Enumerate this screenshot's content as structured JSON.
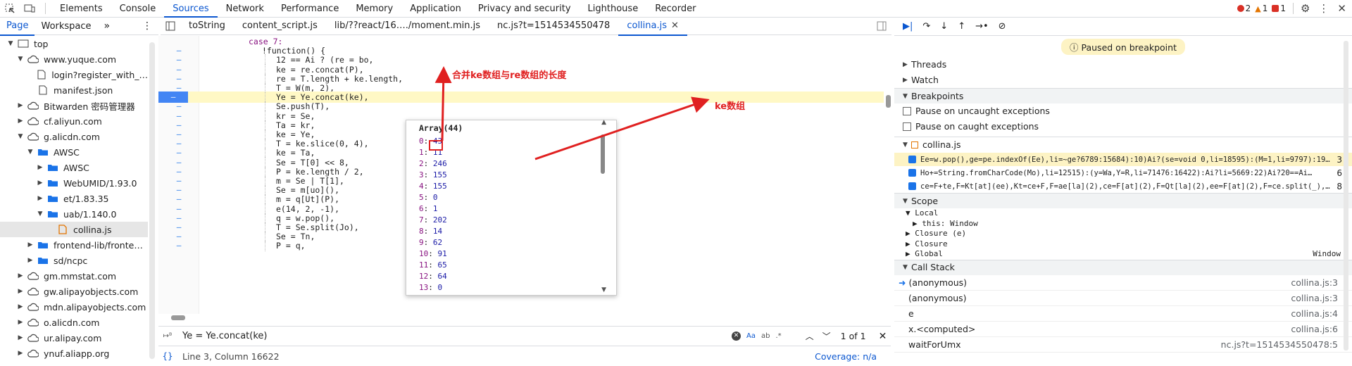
{
  "toolbar": {
    "tabs": [
      "Elements",
      "Console",
      "Sources",
      "Network",
      "Performance",
      "Memory",
      "Application",
      "Privacy and security",
      "Lighthouse",
      "Recorder"
    ],
    "active": "Sources",
    "errors": "2",
    "warnings": "1",
    "issues": "1"
  },
  "navigator": {
    "tabs": [
      "Page",
      "Workspace"
    ],
    "more": "»"
  },
  "tree": [
    {
      "label": "top",
      "depth": 0,
      "arrow": "▼",
      "icon": "frame"
    },
    {
      "label": "www.yuque.com",
      "depth": 1,
      "arrow": "▼",
      "icon": "cloud"
    },
    {
      "label": "login?register_with_…",
      "depth": 2,
      "arrow": "",
      "icon": "file"
    },
    {
      "label": "manifest.json",
      "depth": 2,
      "arrow": "",
      "icon": "file"
    },
    {
      "label": "Bitwarden 密码管理器",
      "depth": 1,
      "arrow": "▶",
      "icon": "cloud"
    },
    {
      "label": "cf.aliyun.com",
      "depth": 1,
      "arrow": "▶",
      "icon": "cloud"
    },
    {
      "label": "g.alicdn.com",
      "depth": 1,
      "arrow": "▼",
      "icon": "cloud"
    },
    {
      "label": "AWSC",
      "depth": 2,
      "arrow": "▼",
      "icon": "folder"
    },
    {
      "label": "AWSC",
      "depth": 3,
      "arrow": "▶",
      "icon": "folder"
    },
    {
      "label": "WebUMID/1.93.0",
      "depth": 3,
      "arrow": "▶",
      "icon": "folder"
    },
    {
      "label": "et/1.83.35",
      "depth": 3,
      "arrow": "▶",
      "icon": "folder"
    },
    {
      "label": "uab/1.140.0",
      "depth": 3,
      "arrow": "▼",
      "icon": "folder"
    },
    {
      "label": "collina.js",
      "depth": 4,
      "arrow": "",
      "icon": "jsfile",
      "selected": true
    },
    {
      "label": "frontend-lib/fronte…",
      "depth": 2,
      "arrow": "▶",
      "icon": "folder"
    },
    {
      "label": "sd/ncpc",
      "depth": 2,
      "arrow": "▶",
      "icon": "folder"
    },
    {
      "label": "gm.mmstat.com",
      "depth": 1,
      "arrow": "▶",
      "icon": "cloud"
    },
    {
      "label": "gw.alipayobjects.com",
      "depth": 1,
      "arrow": "▶",
      "icon": "cloud"
    },
    {
      "label": "mdn.alipayobjects.com",
      "depth": 1,
      "arrow": "▶",
      "icon": "cloud"
    },
    {
      "label": "o.alicdn.com",
      "depth": 1,
      "arrow": "▶",
      "icon": "cloud"
    },
    {
      "label": "ur.alipay.com",
      "depth": 1,
      "arrow": "▶",
      "icon": "cloud"
    },
    {
      "label": "ynuf.aliapp.org",
      "depth": 1,
      "arrow": "▶",
      "icon": "cloud"
    }
  ],
  "editor_tabs": [
    "toString",
    "content_script.js",
    "lib/??react/16…./moment.min.js",
    "nc.js?t=1514534550478",
    "collina.js"
  ],
  "active_editor_tab": "collina.js",
  "code_lines": [
    {
      "indent": 0,
      "text": "case 7:",
      "gutter": ""
    },
    {
      "indent": 1,
      "text": "!function() {",
      "gutter": "–"
    },
    {
      "indent": 2,
      "text": "12 == Ai ? (re = bo,",
      "gutter": "–"
    },
    {
      "indent": 2,
      "text": "ke = re.concat(P),",
      "gutter": "–"
    },
    {
      "indent": 2,
      "text": "re = T.length + ke.length,",
      "gutter": "–"
    },
    {
      "indent": 2,
      "text": "T = W(m, 2),",
      "gutter": "–"
    },
    {
      "indent": 2,
      "text": "Ye = Ye.concat(ke),",
      "gutter": "–",
      "current": true
    },
    {
      "indent": 2,
      "text": "Se.push(T),",
      "gutter": "–"
    },
    {
      "indent": 2,
      "text": "kr = Se,",
      "gutter": "–"
    },
    {
      "indent": 2,
      "text": "Ta = kr,",
      "gutter": "–"
    },
    {
      "indent": 2,
      "text": "ke = Ye,",
      "gutter": "–"
    },
    {
      "indent": 2,
      "text": "T = ke.slice(0, 4),",
      "gutter": "–"
    },
    {
      "indent": 2,
      "text": "ke = Ta,",
      "gutter": "–"
    },
    {
      "indent": 2,
      "text": "Se = T[0] << 8,",
      "gutter": "–"
    },
    {
      "indent": 2,
      "text": "P = ke.length / 2,",
      "gutter": "–"
    },
    {
      "indent": 2,
      "text": "m = Se | T[1],",
      "gutter": "–"
    },
    {
      "indent": 2,
      "text": "Se = m[uo](),",
      "gutter": "–"
    },
    {
      "indent": 2,
      "text": "m = q[Ut](P),",
      "gutter": "–"
    },
    {
      "indent": 2,
      "text": "e(14, 2, -1),",
      "gutter": "–"
    },
    {
      "indent": 2,
      "text": "q = w.pop(),",
      "gutter": "–"
    },
    {
      "indent": 2,
      "text": "T = Se.split(Jo),",
      "gutter": "–"
    },
    {
      "indent": 2,
      "text": "Se = Tn,",
      "gutter": "–"
    },
    {
      "indent": 2,
      "text": "P = q,",
      "gutter": "–"
    }
  ],
  "popup": {
    "title": "Array(44)",
    "items": [
      [
        "0",
        "43"
      ],
      [
        "1",
        "11"
      ],
      [
        "2",
        "246"
      ],
      [
        "3",
        "155"
      ],
      [
        "4",
        "155"
      ],
      [
        "5",
        "0"
      ],
      [
        "6",
        "1"
      ],
      [
        "7",
        "202"
      ],
      [
        "8",
        "14"
      ],
      [
        "9",
        "62"
      ],
      [
        "10",
        "91"
      ],
      [
        "11",
        "65"
      ],
      [
        "12",
        "64"
      ],
      [
        "13",
        "0"
      ]
    ]
  },
  "annotations": {
    "a1": "合并ke数组与re数组的长度",
    "a2": "ke数组"
  },
  "search": {
    "query": "Ye = Ye.concat(ke)",
    "aa": "Aa",
    "regex": ".*",
    "count": "1 of 1"
  },
  "status": {
    "position": "Line 3, Column 16622",
    "coverage": "Coverage: n/a"
  },
  "debugger": {
    "paused": "Paused on breakpoint",
    "threads": "Threads",
    "watch": "Watch",
    "breakpoints": "Breakpoints",
    "pause_uncaught": "Pause on uncaught exceptions",
    "pause_caught": "Pause on caught exceptions",
    "bp_file": "collina.js",
    "bps": [
      {
        "code": "Ee=w.pop(),ge=pe.indexOf(Ee),li=~ge?6789:15684):10)Ai?(se=void 0,li=18595):(M=1,li=9797):19==…",
        "line": "3",
        "active": true
      },
      {
        "code": "Ho+=String.fromCharCode(Mo),li=12515):(y=Wa,Y=R,li=71476:16422):Ai?li=5669:22)Ai?20==Ai…",
        "line": "6",
        "active": false
      },
      {
        "code": "ce=F+te,F=Kt[at](ee),Kt=ce+F,F=ae[la](2),ce=F[at](2),F=Qt[la](2),ee=F[at](2),F=ce.split(_),o…",
        "line": "8",
        "active": false
      }
    ],
    "scope": "Scope",
    "local": "Local",
    "this_label": "this: Window",
    "closure_e": "Closure (e)",
    "closure": "Closure",
    "global": "Global",
    "global_val": "Window",
    "callstack": "Call Stack",
    "frames": [
      {
        "name": "(anonymous)",
        "file": "collina.js:3",
        "current": true
      },
      {
        "name": "(anonymous)",
        "file": "collina.js:3"
      },
      {
        "name": "e",
        "file": "collina.js:4"
      },
      {
        "name": "x.<computed>",
        "file": "collina.js:6"
      },
      {
        "name": "waitForUmx",
        "file": "nc.js?t=1514534550478:5"
      }
    ]
  }
}
